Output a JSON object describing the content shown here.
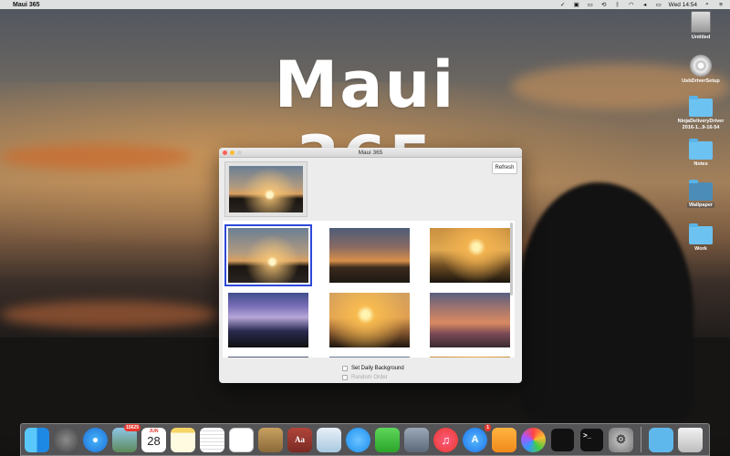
{
  "menubar": {
    "app_name": "Maui 365",
    "clock": "Wed 14:54"
  },
  "wallpaper_title": "Maui 365",
  "desktop_icons": [
    {
      "label": "Untitled",
      "icon": "hard-drive-icon"
    },
    {
      "label": "UsbDriverSetup",
      "icon": "disc-icon"
    },
    {
      "label": "NinjaDeliveryDriver 2016-1...9-16-54",
      "icon": "folder-icon"
    },
    {
      "label": "Notes",
      "icon": "folder-icon"
    },
    {
      "label": "Wallpaper",
      "icon": "folder-icon"
    },
    {
      "label": "Work",
      "icon": "folder-icon"
    }
  ],
  "window": {
    "title": "Maui 365",
    "refresh_label": "Refresh",
    "options": {
      "daily_background": "Set Daily Background",
      "random_order": "Random Order"
    }
  },
  "dock": {
    "calendar_month": "JUN",
    "calendar_day": "28",
    "photos_badge": "15625",
    "appstore_badge": "1",
    "items": [
      "Finder",
      "Launchpad",
      "Safari",
      "Photos",
      "Calendar",
      "Notes",
      "TextEdit",
      "Reminders",
      "Contacts",
      "Dictionary",
      "Preview",
      "Messages",
      "FaceTime",
      "Image Capture",
      "iTunes",
      "App Store",
      "iBooks",
      "Photos App",
      "Activity Monitor",
      "Terminal",
      "System Preferences",
      "Downloads",
      "Trash"
    ]
  }
}
